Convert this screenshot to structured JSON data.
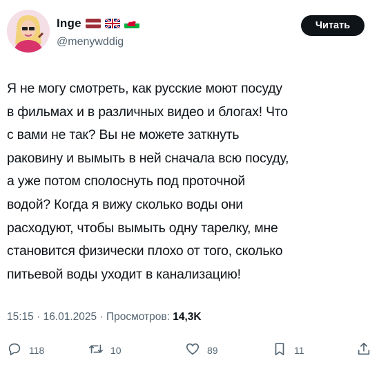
{
  "author": {
    "name": "Inge",
    "handle": "@menywddig",
    "flags": [
      "latvia-flag",
      "uk-flag",
      "wales-flag"
    ]
  },
  "follow_button": {
    "label": "Читать"
  },
  "tweet": {
    "lines": [
      "Я не могу смотреть, как русские моют посуду",
      "в фильмах и в различных видео и блогах! Что",
      "с вами не так? Вы не можете заткнуть",
      "раковину и вымыть в ней сначала всю посуду,",
      "а уже потом сполоснуть под проточной",
      "водой? Когда я вижу сколько воды они",
      "расходуют, чтобы вымыть одну тарелку, мне",
      "становится физически плохо от того, сколько",
      "питьевой воды уходит в канализацию!"
    ],
    "time": "15:15",
    "date": "16.01.2025",
    "views_label": "Просмотров:",
    "views_count": "14,3K"
  },
  "actions": {
    "replies": "118",
    "reposts": "10",
    "likes": "89",
    "bookmarks": "11"
  },
  "colors": {
    "text": "#0f1419",
    "secondary": "#536471",
    "button_bg": "#0f1419"
  }
}
